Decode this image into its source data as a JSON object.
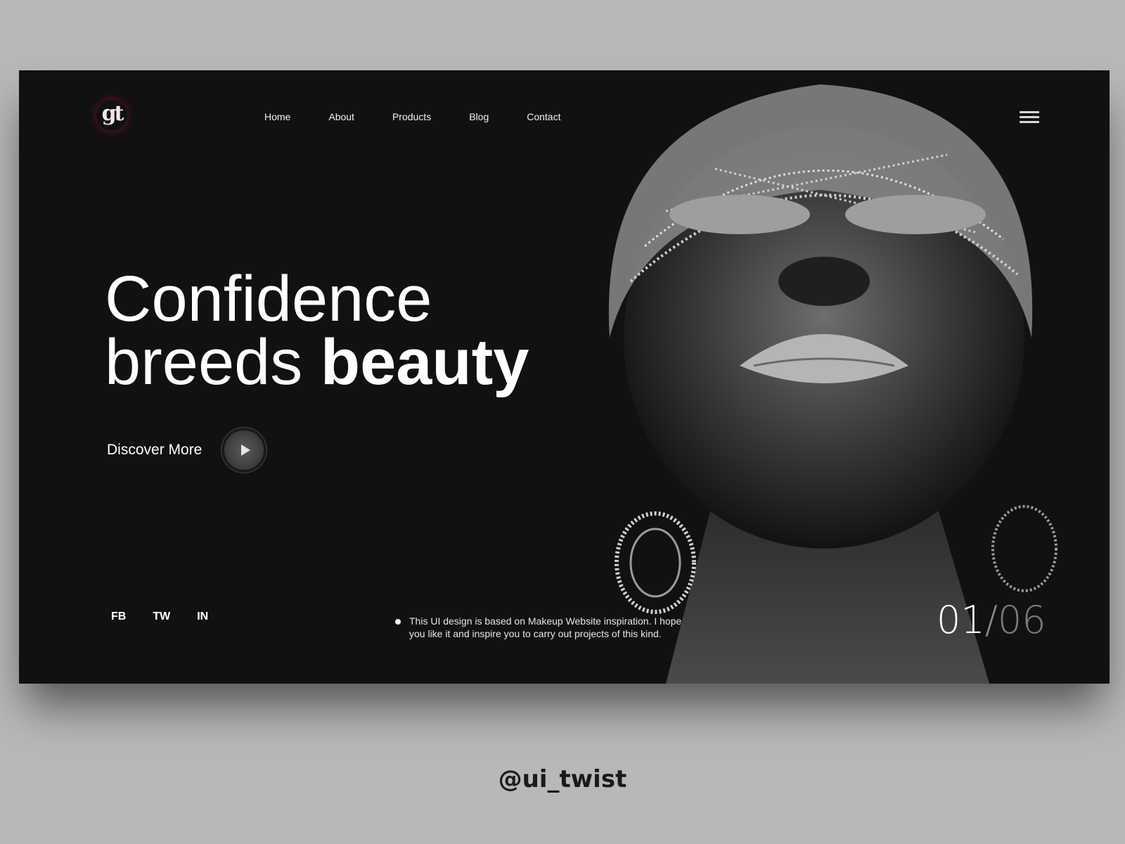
{
  "brand": {
    "logo_text": "gt"
  },
  "nav": {
    "items": [
      {
        "label": "Home"
      },
      {
        "label": "About"
      },
      {
        "label": "Products"
      },
      {
        "label": "Blog"
      },
      {
        "label": "Contact"
      }
    ],
    "menu_icon": "hamburger-menu-icon"
  },
  "hero": {
    "headline_line1": "Confidence",
    "headline_line2_regular": "breeds ",
    "headline_line2_bold": "beauty",
    "cta_label": "Discover More",
    "cta_icon": "play-icon"
  },
  "social": [
    {
      "label": "FB"
    },
    {
      "label": "TW"
    },
    {
      "label": "IN"
    }
  ],
  "note": {
    "text": "This UI design is based on Makeup Website inspiration. I hope you like it and inspire you to carry out projects of this kind."
  },
  "pager": {
    "current": "01",
    "separator": "/",
    "total": "06"
  },
  "watermark": "@ui_twist",
  "colors": {
    "background": "#b8b8b8",
    "card": "#111112",
    "text": "#ffffff"
  }
}
